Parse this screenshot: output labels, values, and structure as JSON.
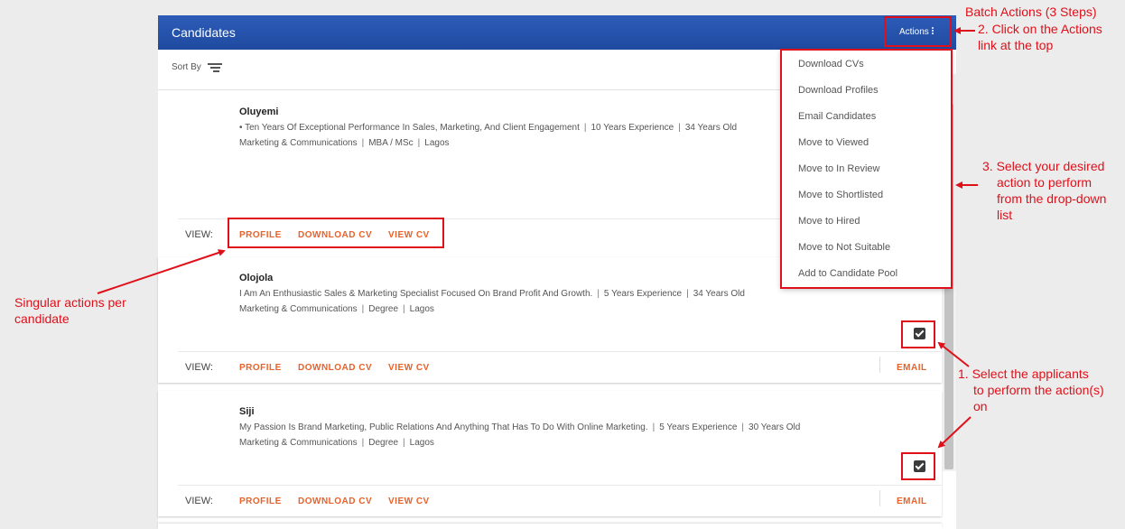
{
  "header": {
    "title": "Candidates",
    "actions_label": "Actions"
  },
  "sort": {
    "label": "Sort By"
  },
  "dropdown": {
    "items": [
      "Download CVs",
      "Download Profiles",
      "Email Candidates",
      "Move to Viewed",
      "Move to In Review",
      "Move to Shortlisted",
      "Move to Hired",
      "Move to Not Suitable",
      "Add to Candidate Pool"
    ]
  },
  "candidates": [
    {
      "name": "Oluyemi",
      "headline": "• Ten Years Of Exceptional Performance In Sales, Marketing, And Client Engagement",
      "experience": "10 Years Experience",
      "age": "34 Years Old",
      "field": "Marketing & Communications",
      "degree": "MBA / MSc",
      "location": "Lagos",
      "selected": false
    },
    {
      "name": "Olojola",
      "headline": "I Am An Enthusiastic Sales & Marketing Specialist Focused On Brand Profit And Growth.",
      "experience": "5 Years Experience",
      "age": "34 Years Old",
      "field": "Marketing & Communications",
      "degree": "Degree",
      "location": "Lagos",
      "selected": true
    },
    {
      "name": "Siji",
      "headline": "My Passion Is Brand Marketing, Public Relations And Anything That Has To Do With Online Marketing.",
      "experience": "5 Years Experience",
      "age": "30 Years Old",
      "field": "Marketing & Communications",
      "degree": "Degree",
      "location": "Lagos",
      "selected": true
    }
  ],
  "card_actions": {
    "view_label": "VIEW:",
    "profile": "PROFILE",
    "download_cv": "DOWNLOAD CV",
    "view_cv": "VIEW CV",
    "email": "EMAIL"
  },
  "annotations": {
    "title": "Batch Actions (3 Steps)",
    "step2_line1": "2. Click on the Actions",
    "step2_line2": "link at the top",
    "step3_line1": "3. Select your desired",
    "step3_line2": "action to perform",
    "step3_line3": "from the drop-down",
    "step3_line4": "list",
    "step1_line1": "1. Select the applicants",
    "step1_line2": "to perform the action(s)",
    "step1_line3": "on",
    "singular_line1": "Singular actions per",
    "singular_line2": "candidate",
    "color": "#e0101a"
  },
  "colors": {
    "header_blue": "#2454b0",
    "action_orange": "#e8622a",
    "annotation_red": "#e0101a"
  }
}
